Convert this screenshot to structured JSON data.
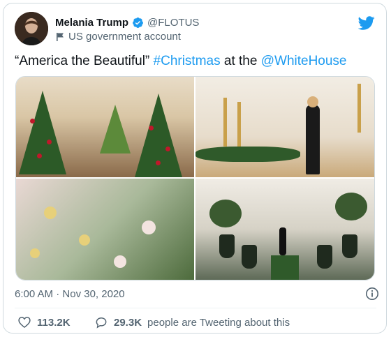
{
  "author": {
    "name": "Melania Trump",
    "handle": "@FLOTUS",
    "label": "US government account"
  },
  "tweet": {
    "text_prefix": "“America the Beautiful” ",
    "hashtag": "#Christmas",
    "text_middle": " at the ",
    "mention": "@WhiteHouse"
  },
  "meta": {
    "time": "6:00 AM",
    "separator": " · ",
    "date": "Nov 30, 2020"
  },
  "actions": {
    "likes": "113.2K",
    "retweets_count": "29.3K",
    "retweets_text": "people are Tweeting about this"
  },
  "colors": {
    "accent": "#1d9bf0",
    "text_primary": "#0f1419",
    "text_secondary": "#536471"
  },
  "icons": [
    "verified-badge-icon",
    "government-flag-icon",
    "twitter-bird-icon",
    "info-icon",
    "heart-icon",
    "reply-bubble-icon"
  ]
}
